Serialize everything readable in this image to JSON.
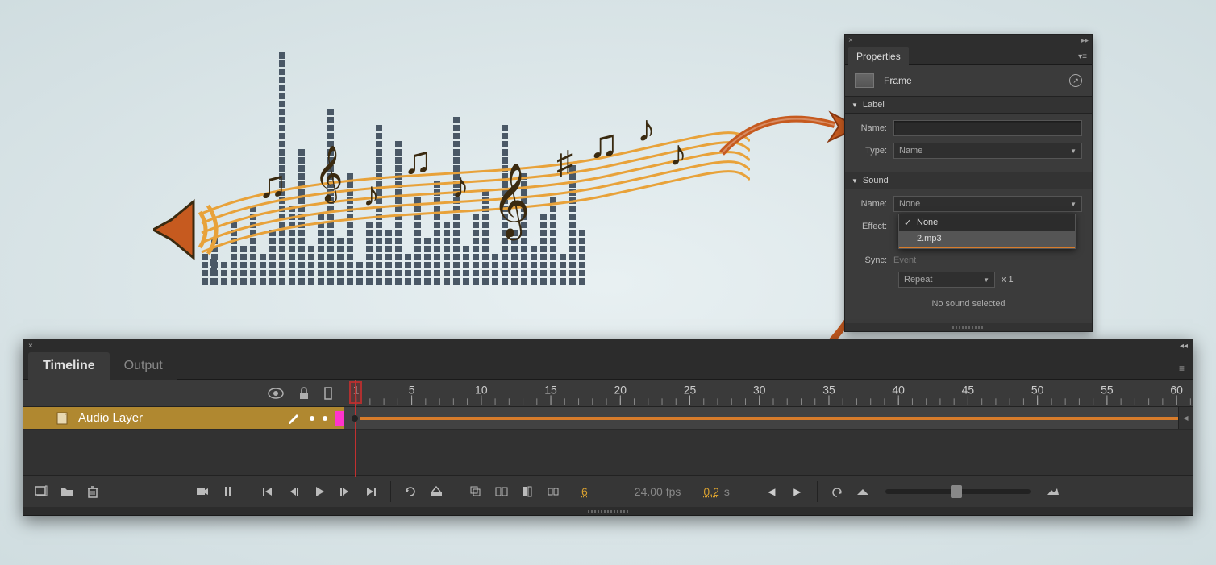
{
  "properties": {
    "tab": "Properties",
    "frame_title": "Frame",
    "sections": {
      "label": {
        "title": "Label",
        "name_lbl": "Name:",
        "type_lbl": "Type:",
        "type_value": "Name"
      },
      "sound": {
        "title": "Sound",
        "name_lbl": "Name:",
        "name_value": "None",
        "dropdown_options": [
          "None",
          "2.mp3"
        ],
        "effect_lbl": "Effect:",
        "sync_lbl": "Sync:",
        "sync_value": "Event",
        "repeat_value": "Repeat",
        "repeat_count": "x  1",
        "nosound_msg": "No sound selected"
      }
    }
  },
  "timeline": {
    "tabs": {
      "timeline": "Timeline",
      "output": "Output"
    },
    "layer_name": "Audio Layer",
    "ruler_marks": [
      "1",
      "5",
      "10",
      "15",
      "20",
      "25",
      "30",
      "35",
      "40",
      "45",
      "50",
      "55",
      "60"
    ],
    "status": {
      "current_frame": "6",
      "fps": "24.00 fps",
      "time_val": "0.2",
      "time_unit": "s"
    }
  }
}
